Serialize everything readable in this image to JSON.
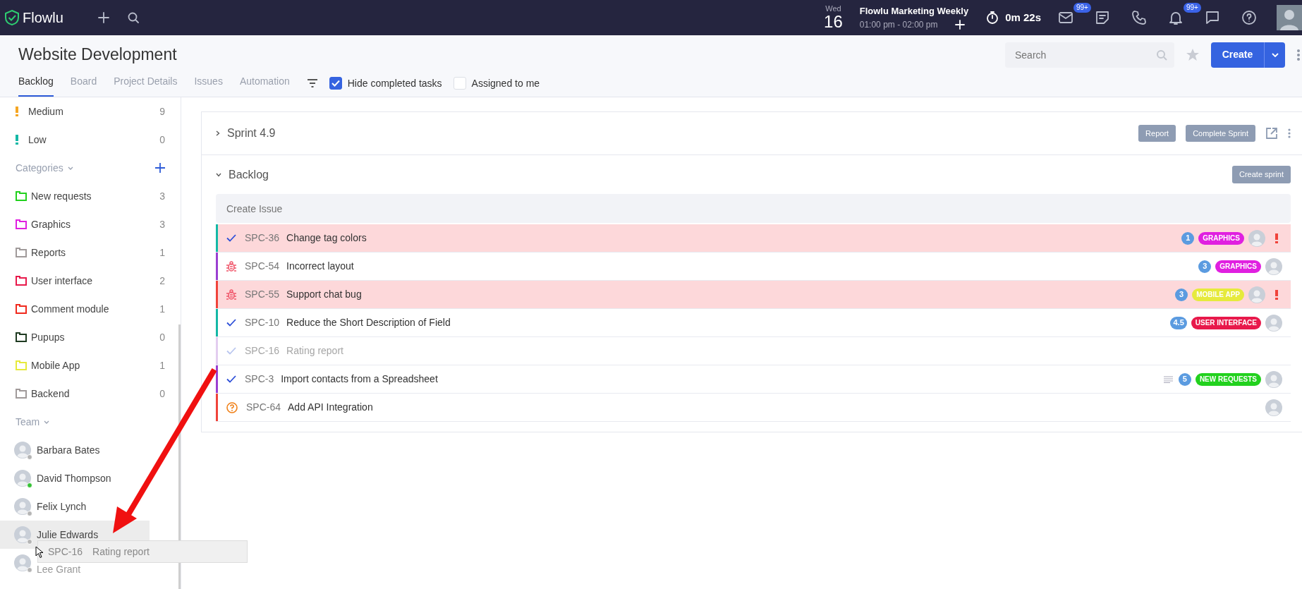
{
  "topbar": {
    "logo": "Flowlu",
    "date": {
      "weekday": "Wed",
      "day": "16"
    },
    "event": {
      "title": "Flowlu Marketing Weekly",
      "time": "01:00 pm - 02:00 pm"
    },
    "timer": "0m 22s",
    "mail_badge": "99+",
    "notifications_badge": "99+"
  },
  "header": {
    "title": "Website Development",
    "search": {
      "placeholder": "Search"
    },
    "create_button": "Create",
    "tabs": [
      {
        "label": "Backlog",
        "selected": true
      },
      {
        "label": "Board",
        "selected": false
      },
      {
        "label": "Project Details",
        "selected": false
      },
      {
        "label": "Issues",
        "selected": false
      },
      {
        "label": "Automation",
        "selected": false
      }
    ],
    "filters": [
      {
        "label": "Hide completed tasks",
        "checked": true
      },
      {
        "label": "Assigned to me",
        "checked": false
      }
    ]
  },
  "sidebar": {
    "priorities": [
      {
        "label": "Medium",
        "count": "9",
        "color": "#f5a623"
      },
      {
        "label": "Low",
        "count": "0",
        "color": "#14b8a6"
      }
    ],
    "categories_title": "Categories",
    "categories": [
      {
        "label": "New requests",
        "count": "3",
        "color": "#22d11e"
      },
      {
        "label": "Graphics",
        "count": "3",
        "color": "#e020e0"
      },
      {
        "label": "Reports",
        "count": "1",
        "color": "#a09a9a"
      },
      {
        "label": "User interface",
        "count": "2",
        "color": "#e8194b"
      },
      {
        "label": "Comment module",
        "count": "1",
        "color": "#f02a1e"
      },
      {
        "label": "Pupups",
        "count": "0",
        "color": "#1f3b22"
      },
      {
        "label": "Mobile App",
        "count": "1",
        "color": "#e6ea3c"
      },
      {
        "label": "Backend",
        "count": "0",
        "color": "#a09a9a"
      }
    ],
    "team_title": "Team",
    "team": [
      {
        "name": "Barbara Bates",
        "online": false,
        "selected": false
      },
      {
        "name": "David Thompson",
        "online": true,
        "selected": false
      },
      {
        "name": "Felix Lynch",
        "online": false,
        "selected": false
      },
      {
        "name": "Julie Edwards",
        "online": false,
        "selected": true
      },
      {
        "name": "Lee Grant",
        "online": false,
        "selected": false
      }
    ]
  },
  "sprint": {
    "title": "Sprint 4.9",
    "expanded": false,
    "buttons": [
      "Report",
      "Complete Sprint"
    ]
  },
  "backlog": {
    "title": "Backlog",
    "expanded": true,
    "create_sprint": "Create sprint",
    "create_issue": {
      "placeholder": "Create Issue"
    },
    "issues": [
      {
        "kind": "task",
        "id": "SPC-36",
        "title": "Change tag colors",
        "color": "#14b8a6",
        "highlighted": true,
        "dimmed": false,
        "description": false,
        "points": "1",
        "tag": {
          "label": "GRAPHICS",
          "color": "#e020e0"
        },
        "urgent": true
      },
      {
        "kind": "bug",
        "id": "SPC-54",
        "title": "Incorrect layout",
        "color": "#9b3fd1",
        "highlighted": false,
        "dimmed": false,
        "description": false,
        "points": "3",
        "tag": {
          "label": "GRAPHICS",
          "color": "#e020e0"
        },
        "urgent": false
      },
      {
        "kind": "bug",
        "id": "SPC-55",
        "title": "Support chat bug",
        "color": "#f0433a",
        "highlighted": true,
        "dimmed": false,
        "description": false,
        "points": "3",
        "tag": {
          "label": "MOBILE APP",
          "color": "#e6ea3c"
        },
        "urgent": true
      },
      {
        "kind": "task",
        "id": "SPC-10",
        "title": "Reduce the Short Description of Field",
        "color": "#14b8a6",
        "highlighted": false,
        "dimmed": false,
        "description": false,
        "points": "4.5",
        "tag": {
          "label": "USER INTERFACE",
          "color": "#e8194b"
        },
        "urgent": false
      },
      {
        "kind": "task",
        "id": "SPC-16",
        "title": "Rating report",
        "color": "#e3cdf0",
        "highlighted": false,
        "dimmed": true,
        "description": false,
        "urgent": false
      },
      {
        "kind": "task",
        "id": "SPC-3",
        "title": "Import contacts from a Spreadsheet",
        "color": "#9b3fd1",
        "highlighted": false,
        "dimmed": false,
        "description": true,
        "points": "5",
        "tag": {
          "label": "NEW REQUESTS",
          "color": "#22d11e"
        },
        "urgent": false
      },
      {
        "kind": "question",
        "id": "SPC-64",
        "title": "Add API Integration",
        "color": "#f0433a",
        "highlighted": false,
        "dimmed": false,
        "description": false,
        "urgent": false
      }
    ]
  },
  "drag_ghost": {
    "id": "SPC-16",
    "title": "Rating report"
  }
}
